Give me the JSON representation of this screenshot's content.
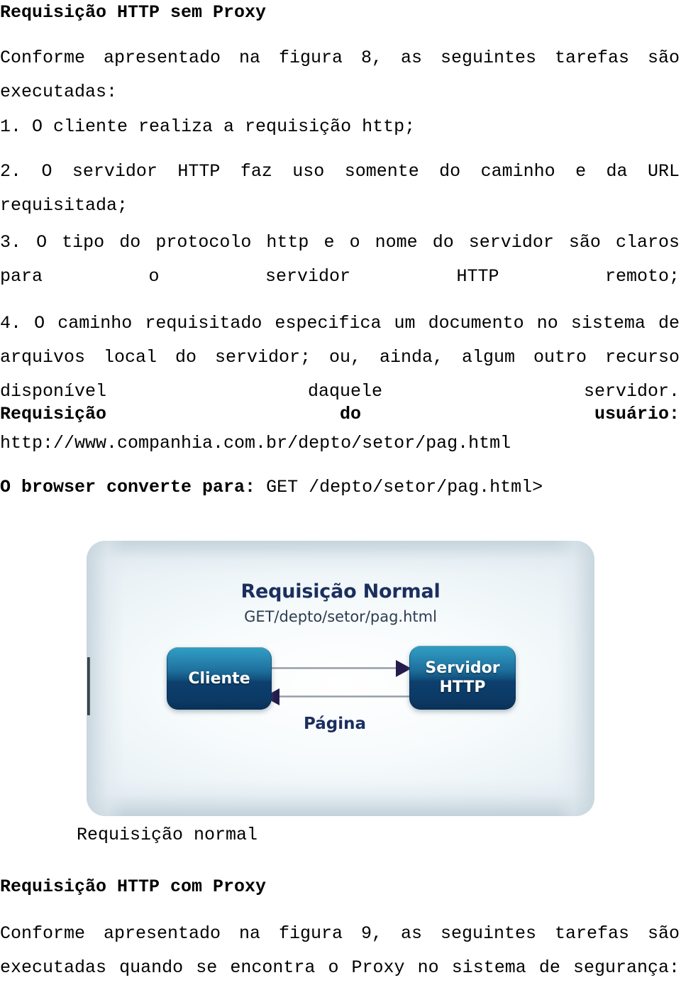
{
  "document": {
    "section1": {
      "heading": "Requisição HTTP sem Proxy",
      "intro": "Conforme apresentado na figura 8, as seguintes tarefas são executadas:",
      "steps": [
        "1. O cliente realiza a requisição http;",
        "2. O servidor HTTP faz uso somente do caminho e da URL requisitada;",
        "3. O tipo do protocolo http e o nome do servidor são claros para o servidor HTTP remoto;",
        "4. O caminho requisitado especifica um documento no sistema de arquivos local do servidor; ou, ainda, algum outro recurso disponível daquele servidor."
      ],
      "request_label": "Requisição do usuário:",
      "request_label_words": [
        "Requisição",
        "do",
        "usuário:"
      ],
      "request_url": "http://www.companhia.com.br/depto/setor/pag.html",
      "convert_label": "O browser converte para:",
      "convert_value": "GET /depto/setor/pag.html>"
    },
    "figure": {
      "title": "Requisição Normal",
      "subtitle": "GET/depto/setor/pag.html",
      "node_client": "Cliente",
      "node_server_line1": "Servidor",
      "node_server_line2": "HTTP",
      "arrow_response_label": "Página",
      "caption": "Requisição normal",
      "colors": {
        "node_top": "#2f9fc4",
        "node_bottom": "#0a3159",
        "title_text": "#1b2f5e",
        "arrow_head": "#241c4d",
        "arrow_line": "#8d94a1",
        "frame_bg": "#e2ebf0"
      }
    },
    "section2": {
      "heading": "Requisição HTTP com Proxy",
      "intro": "Conforme apresentado na figura 9, as seguintes tarefas são executadas quando se encontra o Proxy no sistema de segurança:"
    }
  }
}
